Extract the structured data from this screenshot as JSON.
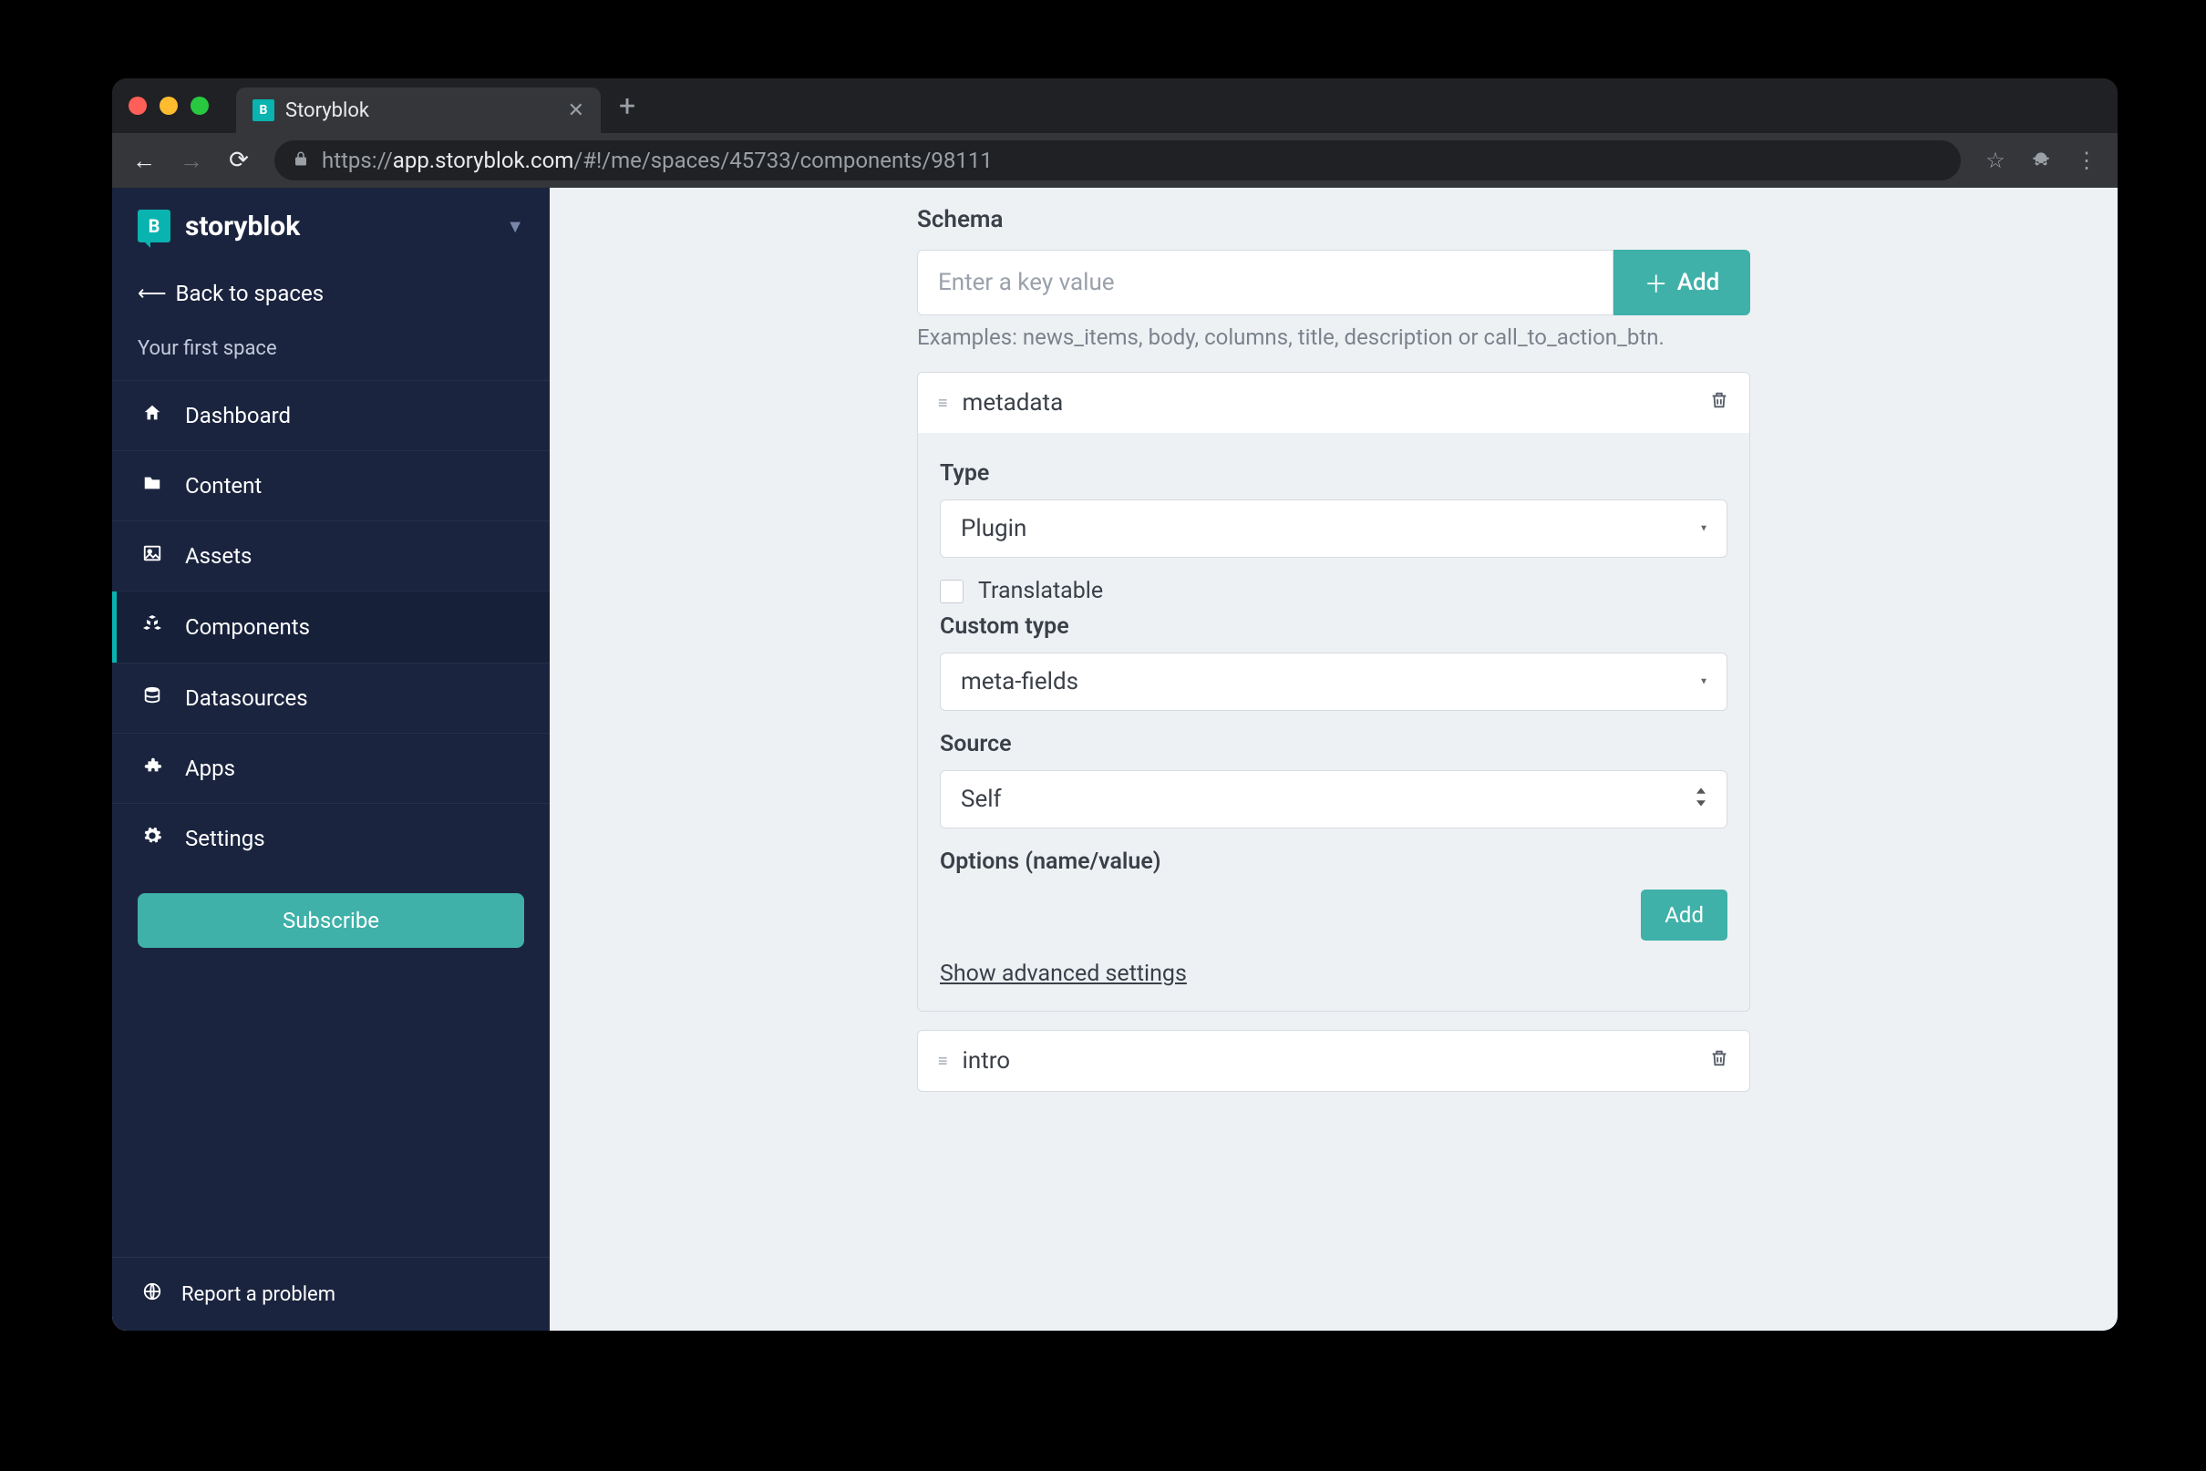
{
  "browser": {
    "tab_title": "Storyblok",
    "url_display_proto": "https://",
    "url_display_host": "app.storyblok.com",
    "url_display_path": "/#!/me/spaces/45733/components/98111"
  },
  "sidebar": {
    "brand": "storyblok",
    "back_label": "Back to spaces",
    "space_name": "Your first space",
    "items": [
      {
        "icon": "home",
        "label": "Dashboard",
        "active": false
      },
      {
        "icon": "folder",
        "label": "Content",
        "active": false
      },
      {
        "icon": "image",
        "label": "Assets",
        "active": false
      },
      {
        "icon": "cubes",
        "label": "Components",
        "active": true
      },
      {
        "icon": "db",
        "label": "Datasources",
        "active": false
      },
      {
        "icon": "puzzle",
        "label": "Apps",
        "active": false
      },
      {
        "icon": "gear",
        "label": "Settings",
        "active": false
      }
    ],
    "subscribe_label": "Subscribe",
    "report_label": "Report a problem"
  },
  "main": {
    "schema_label": "Schema",
    "schema_placeholder": "Enter a key value",
    "add_button": "Add",
    "examples": "Examples: news_items, body, columns, title, description or call_to_action_btn.",
    "field1": {
      "name": "metadata",
      "type_label": "Type",
      "type_value": "Plugin",
      "translatable_label": "Translatable",
      "custom_type_label": "Custom type",
      "custom_type_value": "meta-fields",
      "source_label": "Source",
      "source_value": "Self",
      "options_label": "Options (name/value)",
      "options_add": "Add",
      "advanced_link": "Show advanced settings"
    },
    "field2": {
      "name": "intro"
    }
  }
}
